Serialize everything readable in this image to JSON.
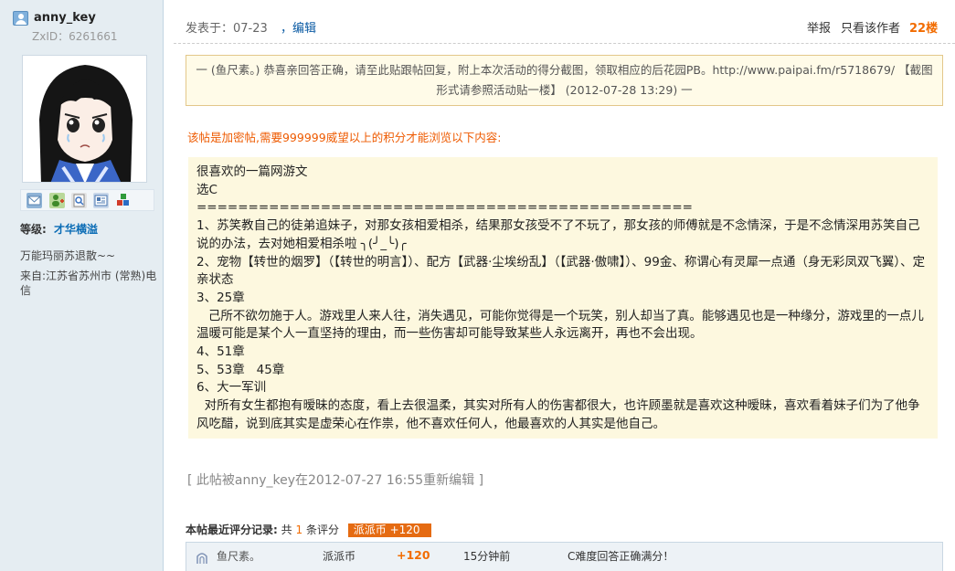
{
  "user": {
    "name": "anny_key",
    "zxid": "ZxID：6261661",
    "level_label": "等级:",
    "level_value": "才华横溢",
    "signature": "万能玛丽苏退散~~",
    "location": "来自:江苏省苏州市 (常熟)电信",
    "tool_icons": [
      "message-icon",
      "add-friend-icon",
      "view-profile-icon",
      "user-card-icon",
      "more-tools-icon"
    ]
  },
  "post": {
    "meta": "发表于：07-23",
    "edit_link": "，编辑",
    "report": "举报",
    "only_author": "只看该作者",
    "floor": "22楼",
    "notice": "一 (鱼尺素。) 恭喜亲回答正确，请至此贴跟帖回复，附上本次活动的得分截图，领取相应的后花园PB。http://www.paipai.fm/r5718679/ 【截图形式请参照活动贴一楼】 (2012-07-28 13:29) 一",
    "encrypted_notice": "该帖是加密帖,需要999999威望以上的积分才能浏览以下内容:",
    "content_lines": [
      "很喜欢的一篇网游文",
      "选C",
      "================================================",
      "1、苏笑教自己的徒弟追妹子，对那女孩相爱相杀，结果那女孩受不了不玩了，那女孩的师傅就是不念情深，于是不念情深用苏笑自己说的办法，去对她相爱相杀啦 ╮(╯_╰)╭",
      "2、宠物【转世的烟罗】（【转世的明言】）、配方【武器·尘埃纷乱】（【武器·傲啸】）、99金、称谓心有灵犀一点通（身无彩凤双飞翼）、定亲状态",
      "3、25章",
      "   己所不欲勿施于人。游戏里人来人往，消失遇见，可能你觉得是一个玩笑，别人却当了真。能够遇见也是一种缘分，游戏里的一点儿温暖可能是某个人一直坚持的理由，而一些伤害却可能导致某些人永远离开，再也不会出现。",
      "4、51章",
      "5、53章   45章",
      "6、大一军训",
      "  对所有女生都抱有暧昧的态度，看上去很温柔，其实对所有人的伤害都很大，也许顾墨就是喜欢这种暧昧，喜欢看着妹子们为了他争风吃醋，说到底其实是虚荣心在作祟，他不喜欢任何人，他最喜欢的人其实是他自己。"
    ],
    "edit_note": "[ 此帖被anny_key在2012-07-27 16:55重新编辑 ]"
  },
  "rating": {
    "title": "本帖最近评分记录:",
    "count_prefix": "共",
    "count": "1",
    "count_suffix": "条评分",
    "badge": "派派币 +120",
    "rows": [
      {
        "rater": "鱼尺素。",
        "item": "派派币",
        "score": "+120",
        "time": "15分钟前",
        "reason": "C难度回答正确满分！"
      }
    ]
  },
  "colors": {
    "sidebar_bg": "#e5edf2",
    "floor": "#f26c00",
    "link": "#0a5aa3",
    "notice_bg": "#fffbe8",
    "content_bg": "#fdf8df",
    "warning": "#ee5a00",
    "badge": "#e56b12"
  }
}
